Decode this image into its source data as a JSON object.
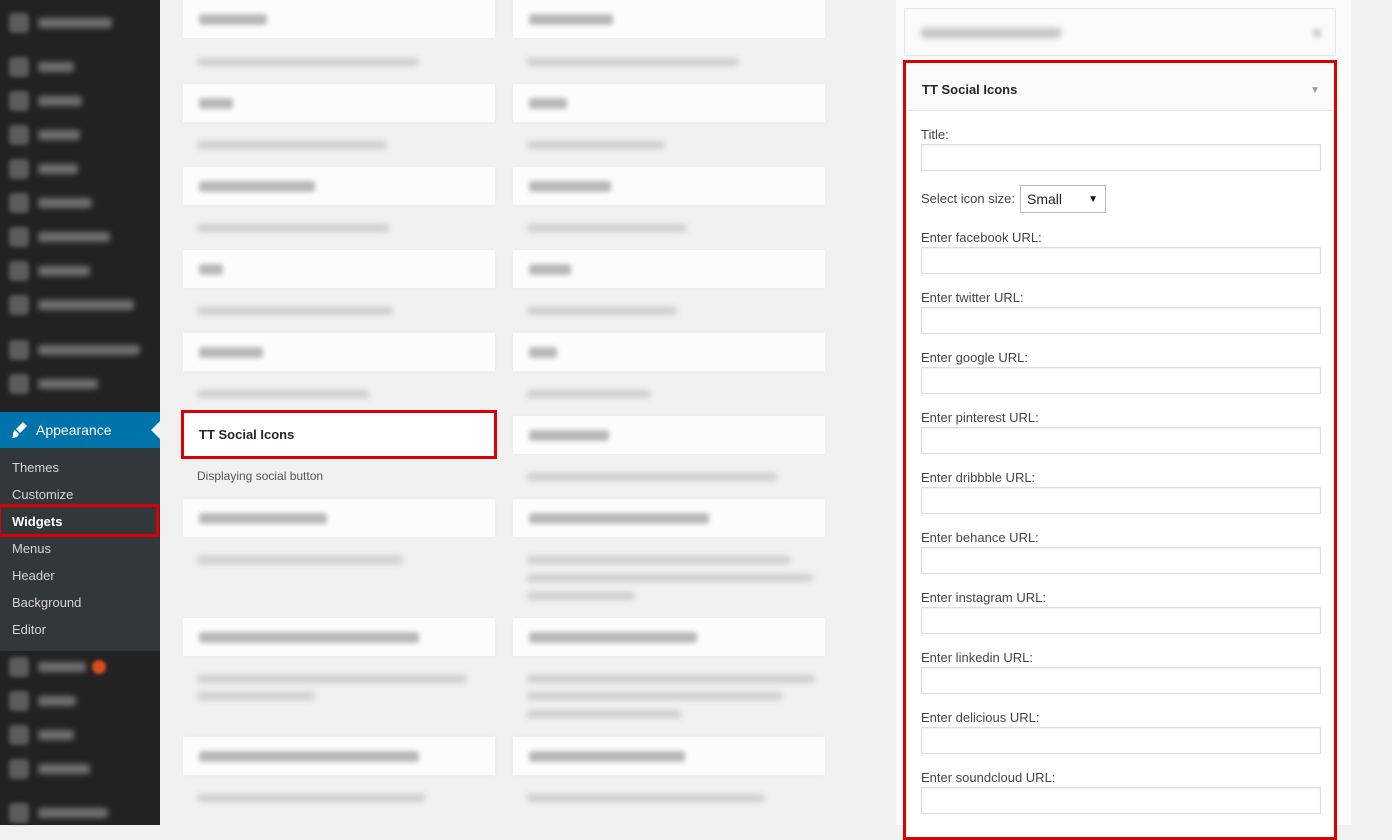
{
  "sidebar": {
    "appearance_label": "Appearance",
    "submenu": [
      "Themes",
      "Customize",
      "Widgets",
      "Menus",
      "Header",
      "Background",
      "Editor"
    ],
    "current": "Widgets"
  },
  "available_widgets": {
    "highlighted_title": "TT Social Icons",
    "highlighted_description": "Displaying social button"
  },
  "panel": {
    "title": "TT Social Icons",
    "title_field_label": "Title:",
    "title_value": "",
    "icon_size_label": "Select icon size:",
    "icon_size_value": "Small",
    "url_fields": [
      {
        "label": "Enter facebook URL:",
        "value": ""
      },
      {
        "label": "Enter twitter URL:",
        "value": ""
      },
      {
        "label": "Enter google URL:",
        "value": ""
      },
      {
        "label": "Enter pinterest URL:",
        "value": ""
      },
      {
        "label": "Enter dribbble URL:",
        "value": ""
      },
      {
        "label": "Enter behance URL:",
        "value": ""
      },
      {
        "label": "Enter instagram URL:",
        "value": ""
      },
      {
        "label": "Enter linkedin URL:",
        "value": ""
      },
      {
        "label": "Enter delicious URL:",
        "value": ""
      },
      {
        "label": "Enter soundcloud URL:",
        "value": ""
      }
    ]
  },
  "colors": {
    "admin_bar": "#222222",
    "accent": "#0073aa",
    "highlight": "#dd0000"
  }
}
